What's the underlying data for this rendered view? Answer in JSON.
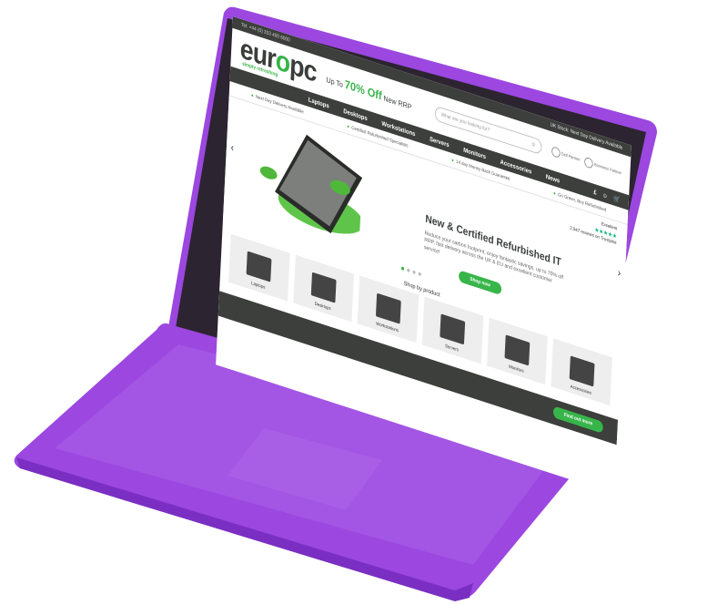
{
  "colors": {
    "device": "#9b47e0",
    "device_dark": "#7a2fc2",
    "brand_green": "#38b54a",
    "charcoal": "#3c3f3b"
  },
  "topbar": {
    "phone": "Tel: +44 (0) 333 400 6000",
    "delivery": "UK Stock: Next Day Delivery Available"
  },
  "header": {
    "logo_text_a": "eur",
    "logo_text_o": "o",
    "logo_text_b": "pc",
    "logo_tagline": "simply refreshing",
    "promo_prefix": "Up To",
    "promo_value": "70% Off",
    "promo_suffix": "New RRP",
    "search_placeholder": "What are you looking for?",
    "partner_1": "Dell Partner",
    "partner_2": "Business Partner"
  },
  "nav": {
    "items": [
      "Laptops",
      "Desktops",
      "Workstations",
      "Servers",
      "Monitors",
      "Accessories",
      "News"
    ]
  },
  "usp": {
    "items": [
      "Next Day Delivery Available",
      "Certified Refurbished Specialists",
      "14 day Money Back Guarantee",
      "Go Green, Buy Refurbished"
    ]
  },
  "hero": {
    "title": "New & Certified Refurbished IT",
    "body": "Reduce your carbon footprint, enjoy fantastic savings, up to 70% off RRP, fast delivery across the UK & EU and excellent customer service!",
    "button": "Shop now",
    "trust_label": "Excellent",
    "trust_reviews": "2,947 reviews on Trustpilot",
    "stars": "★★★★★"
  },
  "shop_by": {
    "title": "Shop by product",
    "categories": [
      "Laptops",
      "Desktops",
      "Workstations",
      "Servers",
      "Monitors",
      "Accessories"
    ]
  },
  "footer": {
    "button": "Find out more"
  }
}
